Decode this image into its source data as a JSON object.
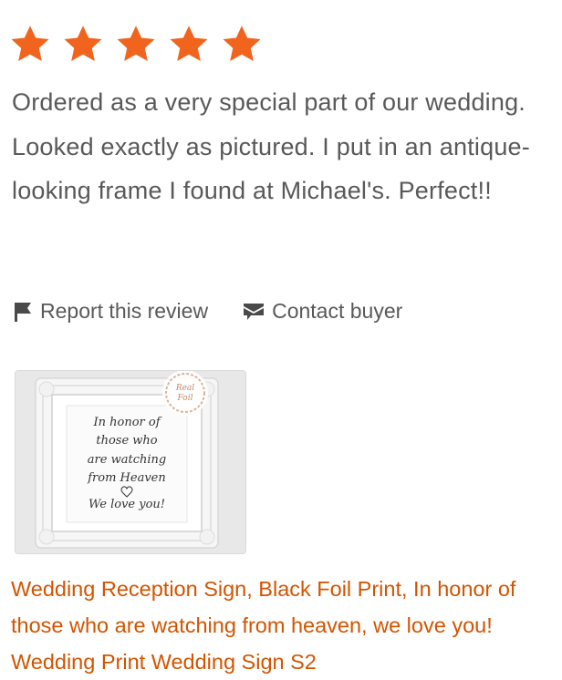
{
  "rating": {
    "stars": 5,
    "max": 5,
    "color": "#f1641e"
  },
  "review": {
    "text": "Ordered as a very special part of our wedding. Looked exactly as pictured. I put in an antique-looking frame I found at Michael's. Perfect!!"
  },
  "actions": {
    "report_icon": "flag-icon",
    "report_label": "Report this review",
    "contact_icon": "envelope-icon",
    "contact_label": "Contact buyer"
  },
  "listing": {
    "image": {
      "sign_lines": [
        "In honor of",
        "those who",
        "are watching",
        "from Heaven",
        "We love you!"
      ],
      "seal_text": [
        "Real",
        "Foil"
      ]
    },
    "title": "Wedding Reception Sign, Black Foil Print, In honor of those who are watching from heaven, we love you! Wedding Print Wedding Sign S2",
    "title_color": "#d35400"
  }
}
